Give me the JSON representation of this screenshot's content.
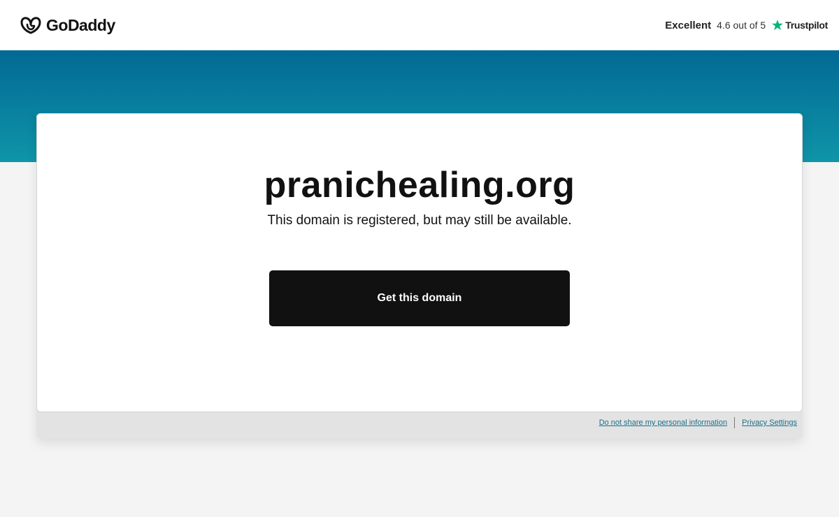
{
  "brand": {
    "name": "GoDaddy",
    "icon": "godaddy-logo-icon"
  },
  "rating": {
    "label": "Excellent",
    "score_text": "4.6 out of 5",
    "provider": "Trustpilot",
    "star_icon": "trustpilot-star-icon",
    "star_color": "#00b67a"
  },
  "colors": {
    "banner_top": "#026994",
    "banner_bottom": "#0f95a8",
    "button": "#111111",
    "link": "#1a6f8c"
  },
  "main": {
    "domain": "pranichealing.org",
    "subtitle": "This domain is registered, but may still be available.",
    "cta_label": "Get this domain"
  },
  "footer": {
    "do_not_share": "Do not share my personal information",
    "privacy_settings": "Privacy Settings"
  }
}
